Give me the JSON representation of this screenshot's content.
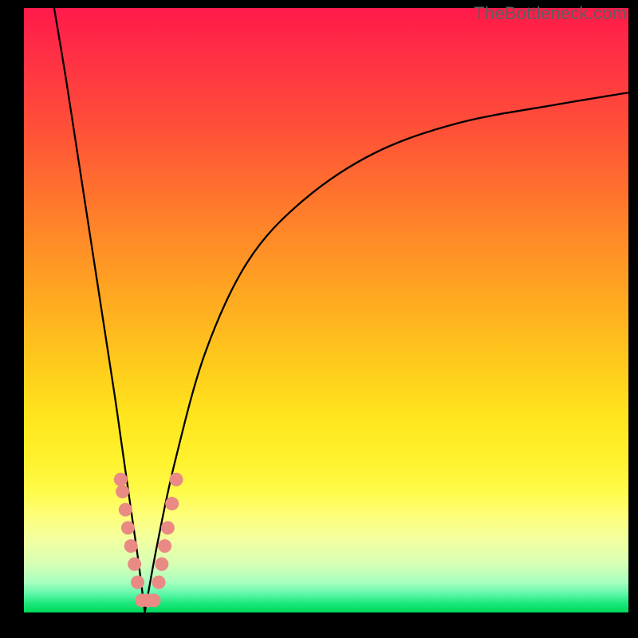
{
  "watermark": "TheBottleneck.com",
  "colors": {
    "dot": "#e98a85",
    "curve": "#000000",
    "frame": "#000000"
  },
  "chart_data": {
    "type": "line",
    "title": "",
    "xlabel": "",
    "ylabel": "",
    "xlim": [
      0,
      100
    ],
    "ylim": [
      0,
      100
    ],
    "note": "Two curves forming a V with minimum near x≈20; dots cluster along both branches near the bottom.",
    "series": [
      {
        "name": "left-branch",
        "x": [
          5,
          7,
          9,
          11,
          13,
          15,
          16,
          17,
          18,
          19,
          20
        ],
        "y": [
          100,
          88,
          75,
          62,
          49,
          36,
          29,
          22,
          15,
          8,
          0
        ]
      },
      {
        "name": "right-branch",
        "x": [
          20,
          22,
          25,
          30,
          37,
          46,
          58,
          72,
          88,
          100
        ],
        "y": [
          0,
          11,
          25,
          43,
          58,
          68,
          76,
          81,
          84,
          86
        ]
      }
    ],
    "scatter": {
      "name": "dots",
      "points": [
        {
          "x": 16.0,
          "y": 22
        },
        {
          "x": 16.3,
          "y": 20
        },
        {
          "x": 16.8,
          "y": 17
        },
        {
          "x": 17.2,
          "y": 14
        },
        {
          "x": 17.7,
          "y": 11
        },
        {
          "x": 18.3,
          "y": 8
        },
        {
          "x": 18.8,
          "y": 5
        },
        {
          "x": 19.5,
          "y": 2
        },
        {
          "x": 20.5,
          "y": 2
        },
        {
          "x": 21.5,
          "y": 2
        },
        {
          "x": 22.3,
          "y": 5
        },
        {
          "x": 22.8,
          "y": 8
        },
        {
          "x": 23.3,
          "y": 11
        },
        {
          "x": 23.8,
          "y": 14
        },
        {
          "x": 24.5,
          "y": 18
        },
        {
          "x": 25.2,
          "y": 22
        }
      ]
    }
  }
}
